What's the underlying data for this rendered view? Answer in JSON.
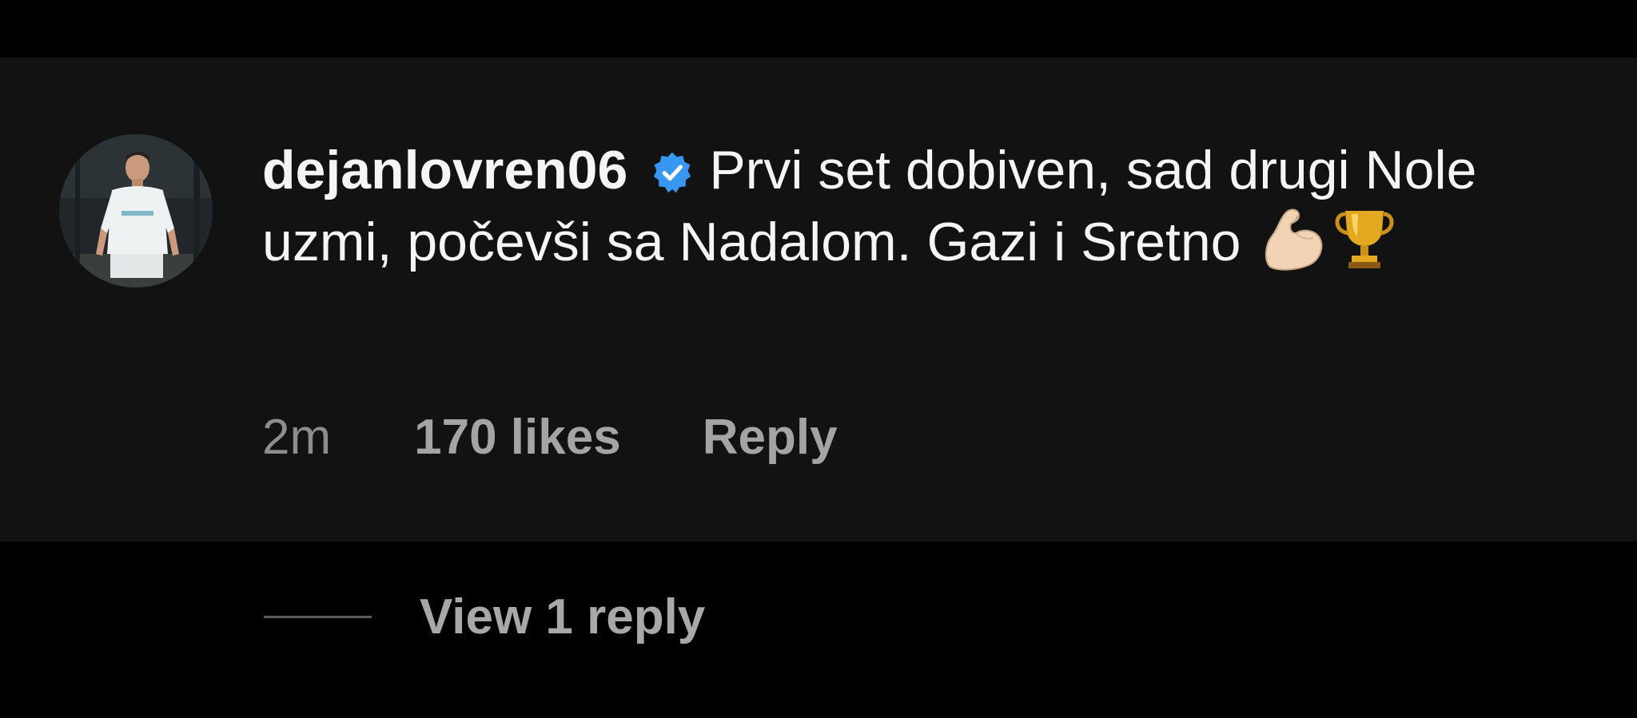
{
  "comment": {
    "username": "dejanlovren06",
    "verified": true,
    "text": "Prvi set dobiven, sad drugi Nole uzmi, počevši sa Nadalom. Gazi i Sretno",
    "emojis": [
      "flexed-biceps-emoji",
      "trophy-emoji"
    ],
    "timestamp": "2m",
    "likes_label": "170 likes",
    "reply_label": "Reply"
  },
  "thread": {
    "view_replies_label": "View 1 reply"
  },
  "colors": {
    "background": "#000000",
    "card_background": "#121212",
    "text_primary": "#f5f5f5",
    "text_secondary": "#a4a4a4",
    "verified_badge": "#3897f0"
  }
}
